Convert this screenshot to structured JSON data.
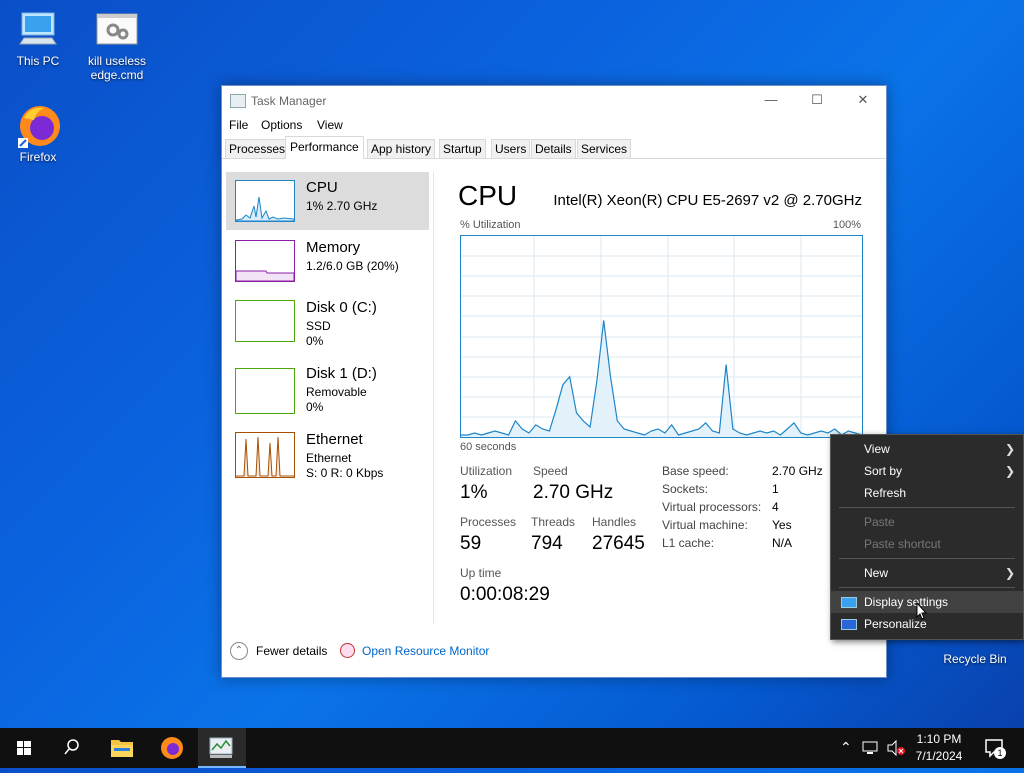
{
  "desktop": {
    "icons": [
      {
        "label": "This PC",
        "icon": "computer-icon"
      },
      {
        "label": "kill useless edge.cmd",
        "icon": "batch-file-icon"
      },
      {
        "label": "Firefox",
        "icon": "firefox-icon"
      },
      {
        "label": "Recycle Bin",
        "icon": "recycle-bin-icon"
      }
    ]
  },
  "window": {
    "title": "Task Manager",
    "menu": [
      "File",
      "Options",
      "View"
    ],
    "tabs": [
      "Processes",
      "Performance",
      "App history",
      "Startup",
      "Users",
      "Details",
      "Services"
    ],
    "active_tab": "Performance",
    "resources": [
      {
        "name": "CPU",
        "line1": "1% 2.70 GHz",
        "line2": "",
        "color": "#1e86c8"
      },
      {
        "name": "Memory",
        "line1": "1.2/6.0 GB (20%)",
        "line2": "",
        "color": "#8b1fa8"
      },
      {
        "name": "Disk 0 (C:)",
        "line1": "SSD",
        "line2": "0%",
        "color": "#4da60c"
      },
      {
        "name": "Disk 1 (D:)",
        "line1": "Removable",
        "line2": "0%",
        "color": "#4da60c"
      },
      {
        "name": "Ethernet",
        "line1": "Ethernet",
        "line2": "S: 0 R: 0 Kbps",
        "color": "#a74f01"
      }
    ],
    "cpu": {
      "title": "CPU",
      "model": "Intel(R) Xeon(R) CPU E5-2697 v2 @ 2.70GHz",
      "graph_label": "% Utilization",
      "graph_max": "100%",
      "graph_time": "60 seconds",
      "utilization_label": "Utilization",
      "utilization": "1%",
      "speed_label": "Speed",
      "speed": "2.70 GHz",
      "processes_label": "Processes",
      "processes": "59",
      "threads_label": "Threads",
      "threads": "794",
      "handles_label": "Handles",
      "handles": "27645",
      "uptime_label": "Up time",
      "uptime": "0:00:08:29",
      "details": [
        {
          "k": "Base speed:",
          "v": "2.70 GHz"
        },
        {
          "k": "Sockets:",
          "v": "1"
        },
        {
          "k": "Virtual processors:",
          "v": "4"
        },
        {
          "k": "Virtual machine:",
          "v": "Yes"
        },
        {
          "k": "L1 cache:",
          "v": "N/A"
        }
      ],
      "history": [
        1,
        1,
        2,
        1,
        2,
        3,
        2,
        1,
        8,
        4,
        2,
        6,
        4,
        3,
        14,
        26,
        30,
        12,
        8,
        5,
        28,
        58,
        30,
        8,
        4,
        3,
        2,
        1,
        3,
        4,
        2,
        6,
        1,
        2,
        3,
        4,
        7,
        3,
        2,
        36,
        4,
        2,
        1,
        2,
        3,
        2,
        3,
        1,
        4,
        7,
        2,
        1,
        2,
        3,
        2,
        4,
        1,
        3,
        2,
        1
      ]
    },
    "footer": {
      "fewer": "Fewer details",
      "monitor": "Open Resource Monitor"
    }
  },
  "context_menu": {
    "items": [
      {
        "label": "View",
        "submenu": true,
        "enabled": true
      },
      {
        "label": "Sort by",
        "submenu": true,
        "enabled": true
      },
      {
        "label": "Refresh",
        "submenu": false,
        "enabled": true
      },
      {
        "label": "Paste",
        "submenu": false,
        "enabled": false
      },
      {
        "label": "Paste shortcut",
        "submenu": false,
        "enabled": false
      },
      {
        "label": "New",
        "submenu": true,
        "enabled": true
      },
      {
        "label": "Display settings",
        "submenu": false,
        "enabled": true,
        "icon": "display-icon"
      },
      {
        "label": "Personalize",
        "submenu": false,
        "enabled": true,
        "icon": "personalize-icon"
      }
    ]
  },
  "taskbar": {
    "time": "1:10 PM",
    "date": "7/1/2024",
    "notification_count": "1"
  }
}
